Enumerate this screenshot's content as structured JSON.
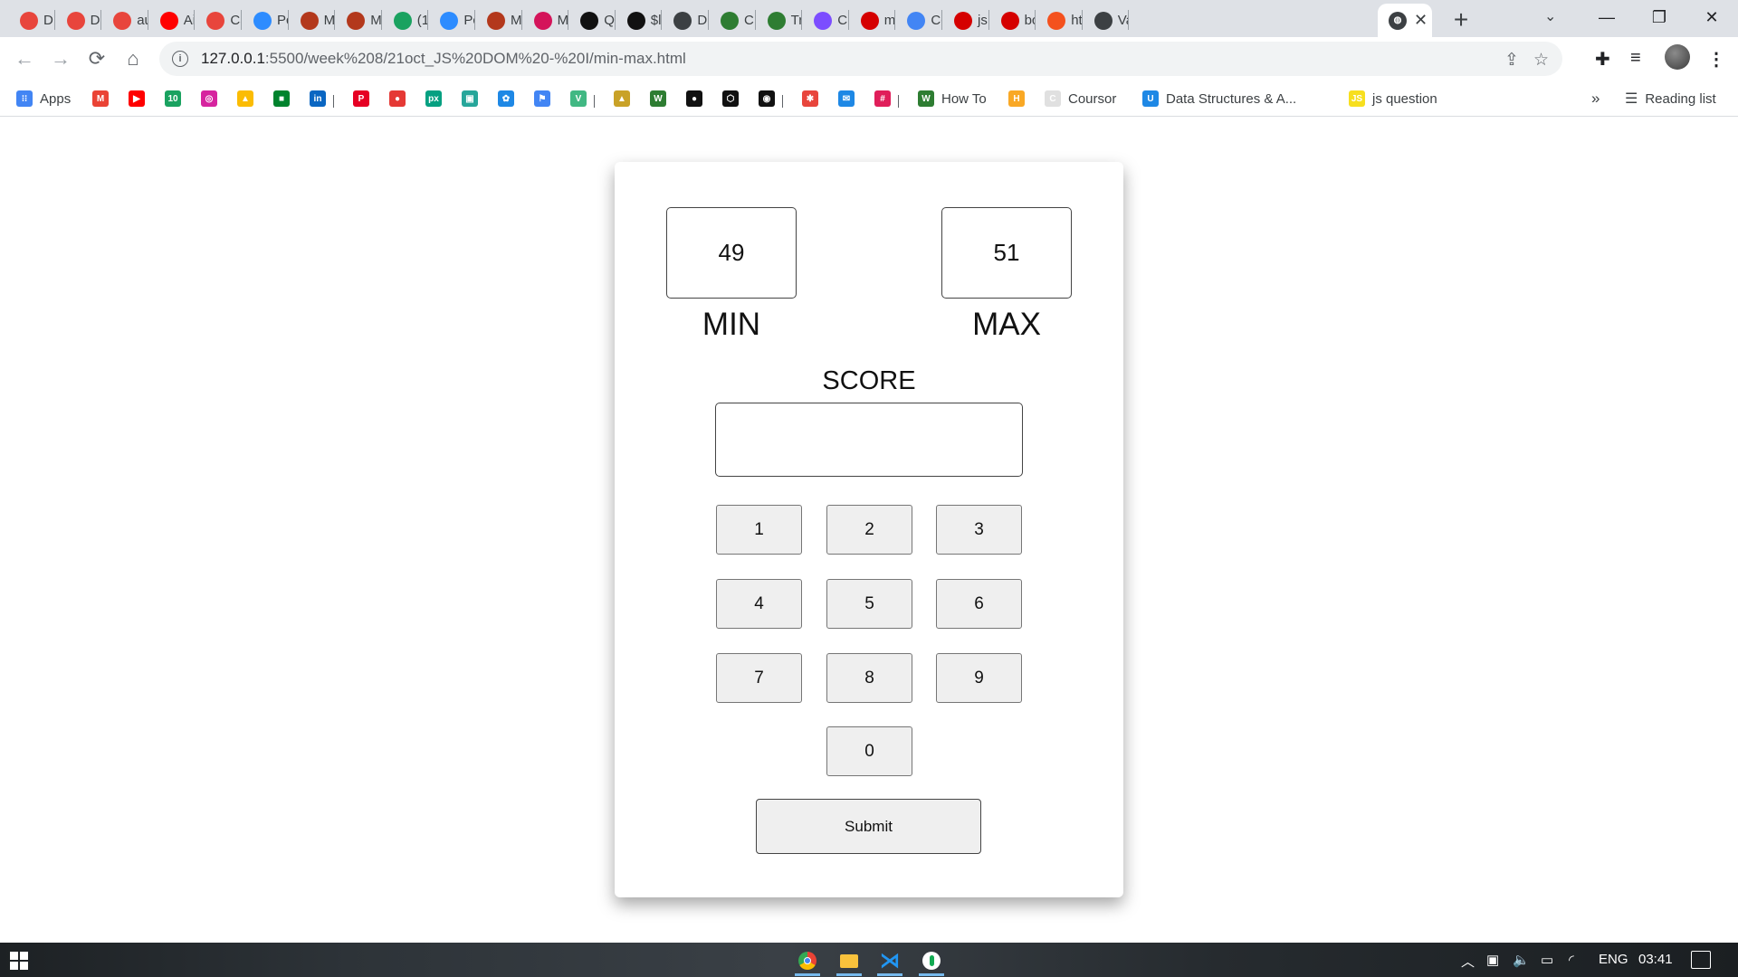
{
  "browser": {
    "tabs": [
      {
        "label": "D:",
        "fav": "#e8453c",
        "icon": "gear-icon"
      },
      {
        "label": "D:",
        "fav": "#e8453c",
        "icon": "gear-icon"
      },
      {
        "label": "au",
        "fav": "#e8453c",
        "icon": "gear-icon"
      },
      {
        "label": "Ai",
        "fav": "#ff0000",
        "icon": "youtube-icon"
      },
      {
        "label": "Ca",
        "fav": "#e8453c",
        "icon": "gear-icon"
      },
      {
        "label": "Pc",
        "fav": "#2d8cff",
        "icon": "zoom-icon"
      },
      {
        "label": "M",
        "fav": "#b3381c",
        "icon": "pin-icon"
      },
      {
        "label": "M",
        "fav": "#b3381c",
        "icon": "pin-icon"
      },
      {
        "label": "(1",
        "fav": "#1aa260",
        "icon": "badge-icon"
      },
      {
        "label": "Pc",
        "fav": "#2d8cff",
        "icon": "zoom-icon"
      },
      {
        "label": "M",
        "fav": "#b3381c",
        "icon": "pin-icon"
      },
      {
        "label": "M",
        "fav": "#d4145a",
        "icon": "m-icon"
      },
      {
        "label": "Q",
        "fav": "#111111",
        "icon": "leaf-icon"
      },
      {
        "label": "$l",
        "fav": "#111111",
        "icon": "leaf-icon"
      },
      {
        "label": "D:",
        "fav": "#3c4043",
        "icon": "globe-icon"
      },
      {
        "label": "C!",
        "fav": "#2e7d32",
        "icon": "w-icon"
      },
      {
        "label": "Tr",
        "fav": "#2e7d32",
        "icon": "w-icon"
      },
      {
        "label": "Cl",
        "fav": "#7c4dff",
        "icon": "check-icon"
      },
      {
        "label": "m",
        "fav": "#d50000",
        "icon": "square-icon"
      },
      {
        "label": "Cc",
        "fav": "#4285f4",
        "icon": "doc-icon"
      },
      {
        "label": "js",
        "fav": "#d50000",
        "icon": "square-icon"
      },
      {
        "label": "bc",
        "fav": "#d50000",
        "icon": "square-icon"
      },
      {
        "label": "ht",
        "fav": "#f4511e",
        "icon": "circle-icon"
      },
      {
        "label": "Va",
        "fav": "#3c4043",
        "icon": "globe-icon"
      }
    ],
    "active_tab": {
      "close": "✕",
      "fav": "#3c4043"
    },
    "new_tab": "+",
    "tab_search": "⌄",
    "window": {
      "minimize": "—",
      "restore": "❐",
      "close": "✕"
    },
    "nav": {
      "back": "←",
      "forward": "→",
      "reload": "⟳",
      "home": "⌂"
    },
    "url_host": "127.0.0.1",
    "url_rest": ":5500/week%208/21oct_JS%20DOM%20-%20I/min-max.html",
    "omnibox_icons": {
      "share": "⇪",
      "star": "☆"
    },
    "toolbar_icons": {
      "extensions": "✚",
      "media": "≡",
      "menu": "⋮"
    },
    "bookmarks": [
      {
        "label": "Apps",
        "fav": "#4285f4",
        "glyph": "⁝⁝",
        "icon": "apps-grid-icon"
      },
      {
        "label": "",
        "fav": "#ea4335",
        "glyph": "M",
        "icon": "gmail-icon"
      },
      {
        "label": "",
        "fav": "#ff0000",
        "glyph": "▶",
        "icon": "youtube-icon"
      },
      {
        "label": "",
        "fav": "#1aa260",
        "glyph": "10",
        "icon": "badge-icon"
      },
      {
        "label": "",
        "fav": "#d6249f",
        "glyph": "◎",
        "icon": "instagram-icon"
      },
      {
        "label": "",
        "fav": "#fbbc04",
        "glyph": "▲",
        "icon": "drive-icon"
      },
      {
        "label": "",
        "fav": "#00832d",
        "glyph": "■",
        "icon": "meet-icon"
      },
      {
        "label": "",
        "fav": "#0a66c2",
        "glyph": "in",
        "icon": "linkedin-icon"
      },
      {
        "label": "",
        "fav": "#e60023",
        "glyph": "P",
        "icon": "pinterest-icon"
      },
      {
        "label": "",
        "fav": "#e53935",
        "glyph": "●",
        "icon": "record-icon"
      },
      {
        "label": "",
        "fav": "#05a081",
        "glyph": "px",
        "icon": "px-icon"
      },
      {
        "label": "",
        "fav": "#26a69a",
        "glyph": "▣",
        "icon": "tile-icon"
      },
      {
        "label": "",
        "fav": "#1e88e5",
        "glyph": "✿",
        "icon": "flower-icon"
      },
      {
        "label": "",
        "fav": "#4285f4",
        "glyph": "⚑",
        "icon": "flag-icon"
      },
      {
        "label": "",
        "fav": "#41b883",
        "glyph": "V",
        "icon": "vue-icon"
      },
      {
        "label": "",
        "fav": "#c9a227",
        "glyph": "▲",
        "icon": "pma-icon"
      },
      {
        "label": "",
        "fav": "#2e7d32",
        "glyph": "W",
        "icon": "w-icon"
      },
      {
        "label": "",
        "fav": "#111111",
        "glyph": "●",
        "icon": "github-icon"
      },
      {
        "label": "",
        "fav": "#111111",
        "glyph": "⬡",
        "icon": "codepen-icon"
      },
      {
        "label": "",
        "fav": "#111111",
        "glyph": "◉",
        "icon": "camera-icon"
      },
      {
        "label": "",
        "fav": "#e8453c",
        "glyph": "✱",
        "icon": "gear-icon"
      },
      {
        "label": "",
        "fav": "#1e88e5",
        "glyph": "✉",
        "icon": "mail-icon"
      },
      {
        "label": "",
        "fav": "#e01e5a",
        "glyph": "#",
        "icon": "slack-icon"
      },
      {
        "label": "How To",
        "fav": "#2e7d32",
        "glyph": "W",
        "icon": "w-icon"
      },
      {
        "label": "",
        "fav": "#f9a825",
        "glyph": "H",
        "icon": "h-icon"
      },
      {
        "label": "Coursor",
        "fav": "#e0e0e0",
        "glyph": "C",
        "icon": "coursor-icon"
      },
      {
        "label": "Data Structures & A...",
        "fav": "#1e88e5",
        "glyph": "U",
        "icon": "udemy-icon"
      },
      {
        "label": "js question",
        "fav": "#f7df1e",
        "glyph": "JS",
        "icon": "js-icon"
      }
    ],
    "bookmarks_more": "»",
    "reading_list": "Reading list"
  },
  "app": {
    "min_value": "49",
    "max_value": "51",
    "min_label": "MIN",
    "max_label": "MAX",
    "score_label": "SCORE",
    "score_value": "",
    "keys": [
      "1",
      "2",
      "3",
      "4",
      "5",
      "6",
      "7",
      "8",
      "9",
      "0"
    ],
    "submit_label": "Submit"
  },
  "taskbar": {
    "apps": [
      {
        "name": "chrome-icon",
        "color": "#4caf50"
      },
      {
        "name": "file-explorer-icon",
        "color": "#f9c23c"
      },
      {
        "name": "vscode-icon",
        "color": "#2196f3"
      },
      {
        "name": "mongodb-compass-icon",
        "color": "#13aa52"
      }
    ],
    "tray": {
      "caret": "︿",
      "language": "ENG",
      "time": "03:41"
    }
  }
}
